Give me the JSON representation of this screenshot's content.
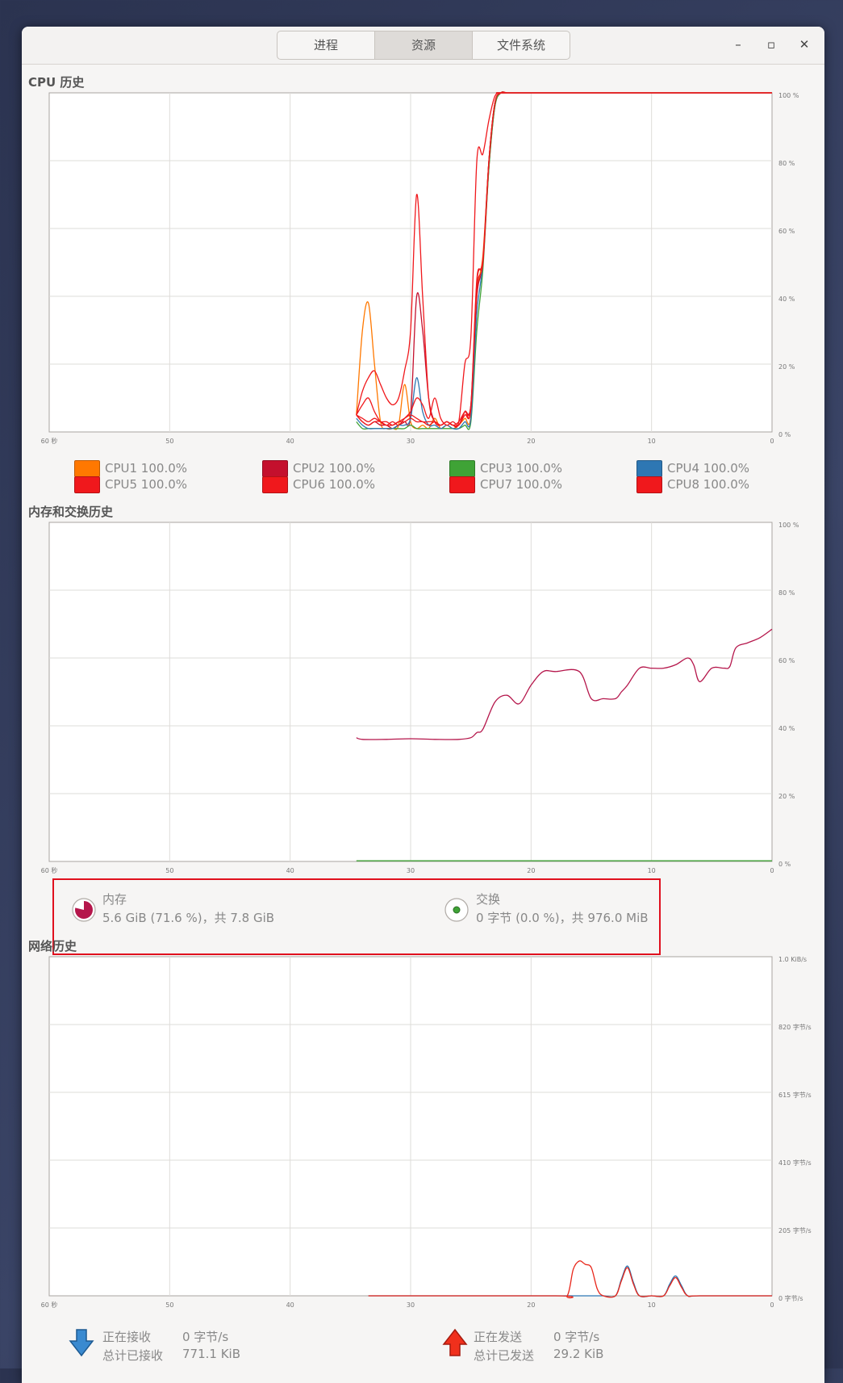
{
  "tabs": [
    {
      "label": "进程"
    },
    {
      "label": "资源"
    },
    {
      "label": "文件系统"
    }
  ],
  "window_controls": {
    "minimize": "–",
    "maximize": "▫",
    "close": "✕"
  },
  "cpu": {
    "title": "CPU 历史",
    "legend": [
      {
        "label": "CPU1 100.0%",
        "color": "#ff7800"
      },
      {
        "label": "CPU2 100.0%",
        "color": "#c4102d"
      },
      {
        "label": "CPU3 100.0%",
        "color": "#3fa336"
      },
      {
        "label": "CPU4 100.0%",
        "color": "#2e77b3"
      },
      {
        "label": "CPU5 100.0%",
        "color": "#f0181c"
      },
      {
        "label": "CPU6 100.0%",
        "color": "#f0181c"
      },
      {
        "label": "CPU7 100.0%",
        "color": "#f0181c"
      },
      {
        "label": "CPU8 100.0%",
        "color": "#f0181c"
      }
    ]
  },
  "memory": {
    "title": "内存和交换历史",
    "mem_label": "内存",
    "mem_value": "5.6 GiB (71.6 %)，共 7.8 GiB",
    "swap_label": "交换",
    "swap_value": "0 字节 (0.0 %)，共 976.0 MiB",
    "mem_color": "#b5164b",
    "swap_color": "#3fa336"
  },
  "network": {
    "title": "网络历史",
    "recv_label": "正在接收",
    "recv_rate": "0 字节/s",
    "recv_total_label": "总计已接收",
    "recv_total": "771.1 KiB",
    "send_label": "正在发送",
    "send_rate": "0 字节/s",
    "send_total_label": "总计已发送",
    "send_total": "29.2 KiB",
    "recv_color": "#2e77b3",
    "send_color": "#e8261a"
  },
  "chart_data": [
    {
      "type": "line",
      "title": "CPU 历史",
      "x_ticks": [
        "60 秒",
        "50",
        "40",
        "30",
        "20",
        "10",
        "0"
      ],
      "y_ticks": [
        "100 %",
        "80 %",
        "60 %",
        "40 %",
        "20 %",
        "0 %"
      ],
      "xlim": [
        60,
        0
      ],
      "ylim": [
        0,
        100
      ],
      "x": [
        34.5,
        34,
        33.5,
        33,
        32.5,
        32,
        31.5,
        31,
        30.5,
        30,
        29.5,
        29,
        28.5,
        28,
        27.5,
        27,
        26.5,
        26,
        25.5,
        25,
        24.5,
        24,
        23.5,
        23,
        22.5,
        22,
        21,
        0
      ],
      "series": [
        {
          "name": "CPU1",
          "values": [
            5,
            30,
            38,
            20,
            3,
            1,
            1,
            2,
            14,
            3,
            1,
            2,
            1,
            4,
            1,
            2,
            1,
            2,
            4,
            5,
            40,
            52,
            80,
            97,
            100,
            100,
            100,
            100
          ]
        },
        {
          "name": "CPU2",
          "values": [
            5,
            3,
            2,
            3,
            2,
            2,
            1,
            2,
            3,
            5,
            40,
            30,
            10,
            3,
            2,
            3,
            2,
            2,
            6,
            8,
            40,
            50,
            78,
            96,
            100,
            100,
            100,
            100
          ]
        },
        {
          "name": "CPU3",
          "values": [
            3,
            1,
            1,
            1,
            1,
            1,
            1,
            1,
            1,
            2,
            1,
            1,
            1,
            1,
            1,
            1,
            1,
            1,
            2,
            3,
            30,
            48,
            78,
            96,
            100,
            100,
            100,
            100
          ]
        },
        {
          "name": "CPU4",
          "values": [
            4,
            2,
            1,
            1,
            1,
            1,
            1,
            2,
            2,
            4,
            16,
            6,
            2,
            2,
            1,
            2,
            1,
            1,
            3,
            4,
            35,
            50,
            80,
            97,
            100,
            100,
            100,
            100
          ]
        },
        {
          "name": "CPU5",
          "values": [
            5,
            12,
            16,
            18,
            14,
            10,
            8,
            10,
            18,
            30,
            70,
            40,
            10,
            3,
            2,
            3,
            2,
            3,
            20,
            28,
            80,
            82,
            92,
            99,
            100,
            100,
            100,
            100
          ]
        },
        {
          "name": "CPU6",
          "values": [
            5,
            8,
            10,
            6,
            3,
            2,
            3,
            2,
            4,
            6,
            10,
            8,
            4,
            10,
            4,
            2,
            3,
            2,
            6,
            8,
            45,
            50,
            80,
            97,
            100,
            100,
            100,
            100
          ]
        },
        {
          "name": "CPU7",
          "values": [
            5,
            3,
            2,
            3,
            3,
            2,
            2,
            3,
            3,
            4,
            3,
            3,
            2,
            3,
            2,
            3,
            2,
            2,
            5,
            7,
            42,
            50,
            80,
            97,
            100,
            100,
            100,
            100
          ]
        },
        {
          "name": "CPU8",
          "values": [
            5,
            4,
            3,
            4,
            3,
            3,
            2,
            3,
            4,
            5,
            4,
            3,
            3,
            3,
            2,
            3,
            2,
            3,
            6,
            7,
            44,
            51,
            80,
            97,
            100,
            100,
            100,
            100
          ]
        }
      ]
    },
    {
      "type": "line",
      "title": "内存和交换历史",
      "x_ticks": [
        "60 秒",
        "50",
        "40",
        "30",
        "20",
        "10",
        "0"
      ],
      "y_ticks": [
        "100 %",
        "80 %",
        "60 %",
        "40 %",
        "20 %",
        "0 %"
      ],
      "xlim": [
        60,
        0
      ],
      "ylim": [
        0,
        100
      ],
      "x": [
        34.5,
        34,
        32,
        30,
        28,
        26,
        25,
        24.5,
        24,
        23,
        22,
        21,
        20,
        19,
        18,
        16,
        15,
        14,
        13,
        12.5,
        12,
        11,
        10,
        9,
        8,
        7,
        6.5,
        6,
        5,
        4,
        3.5,
        3,
        2,
        1,
        0
      ],
      "series": [
        {
          "name": "内存",
          "values": [
            36.5,
            36,
            36,
            36.2,
            36,
            36,
            36.5,
            38,
            39,
            47,
            49,
            46.5,
            52,
            56,
            56,
            56,
            48,
            48,
            48,
            50,
            52,
            57,
            57,
            57,
            58,
            60,
            58,
            53,
            57,
            57,
            57.5,
            63,
            64.5,
            66,
            68.5
          ]
        },
        {
          "name": "交换",
          "values": [
            0.2,
            0.2,
            0.2,
            0.2,
            0.2,
            0.2,
            0.2,
            0.2,
            0.2,
            0.2,
            0.2,
            0.2,
            0.2,
            0.2,
            0.2,
            0.2,
            0.2,
            0.2,
            0.2,
            0.2,
            0.2,
            0.2,
            0.2,
            0.2,
            0.2,
            0.2,
            0.2,
            0.2,
            0.2,
            0.2,
            0.2,
            0.2,
            0.2,
            0.2,
            0.2
          ]
        }
      ]
    },
    {
      "type": "line",
      "title": "网络历史",
      "x_ticks": [
        "60 秒",
        "50",
        "40",
        "30",
        "20",
        "10",
        "0"
      ],
      "y_ticks": [
        "1.0 KiB/s",
        "820 字节/s",
        "615 字节/s",
        "410 字节/s",
        "205 字节/s",
        "0 字节/s"
      ],
      "xlim": [
        60,
        0
      ],
      "ylim": [
        0,
        1024
      ],
      "x": [
        33.5,
        18,
        17,
        16.5,
        16,
        15.5,
        15,
        14.5,
        14,
        13,
        12.5,
        12,
        11.5,
        11,
        10,
        9,
        8.5,
        8,
        7.5,
        7,
        6,
        0
      ],
      "series": [
        {
          "name": "正在接收",
          "values": [
            0,
            0,
            0,
            0,
            0,
            0,
            0,
            0,
            0,
            0,
            50,
            90,
            40,
            0,
            0,
            0,
            35,
            60,
            30,
            0,
            0,
            0
          ]
        },
        {
          "name": "正在发送",
          "values": [
            0,
            0,
            0,
            80,
            105,
            95,
            85,
            20,
            0,
            0,
            45,
            85,
            35,
            0,
            0,
            0,
            30,
            55,
            25,
            0,
            0,
            0
          ]
        }
      ]
    }
  ]
}
